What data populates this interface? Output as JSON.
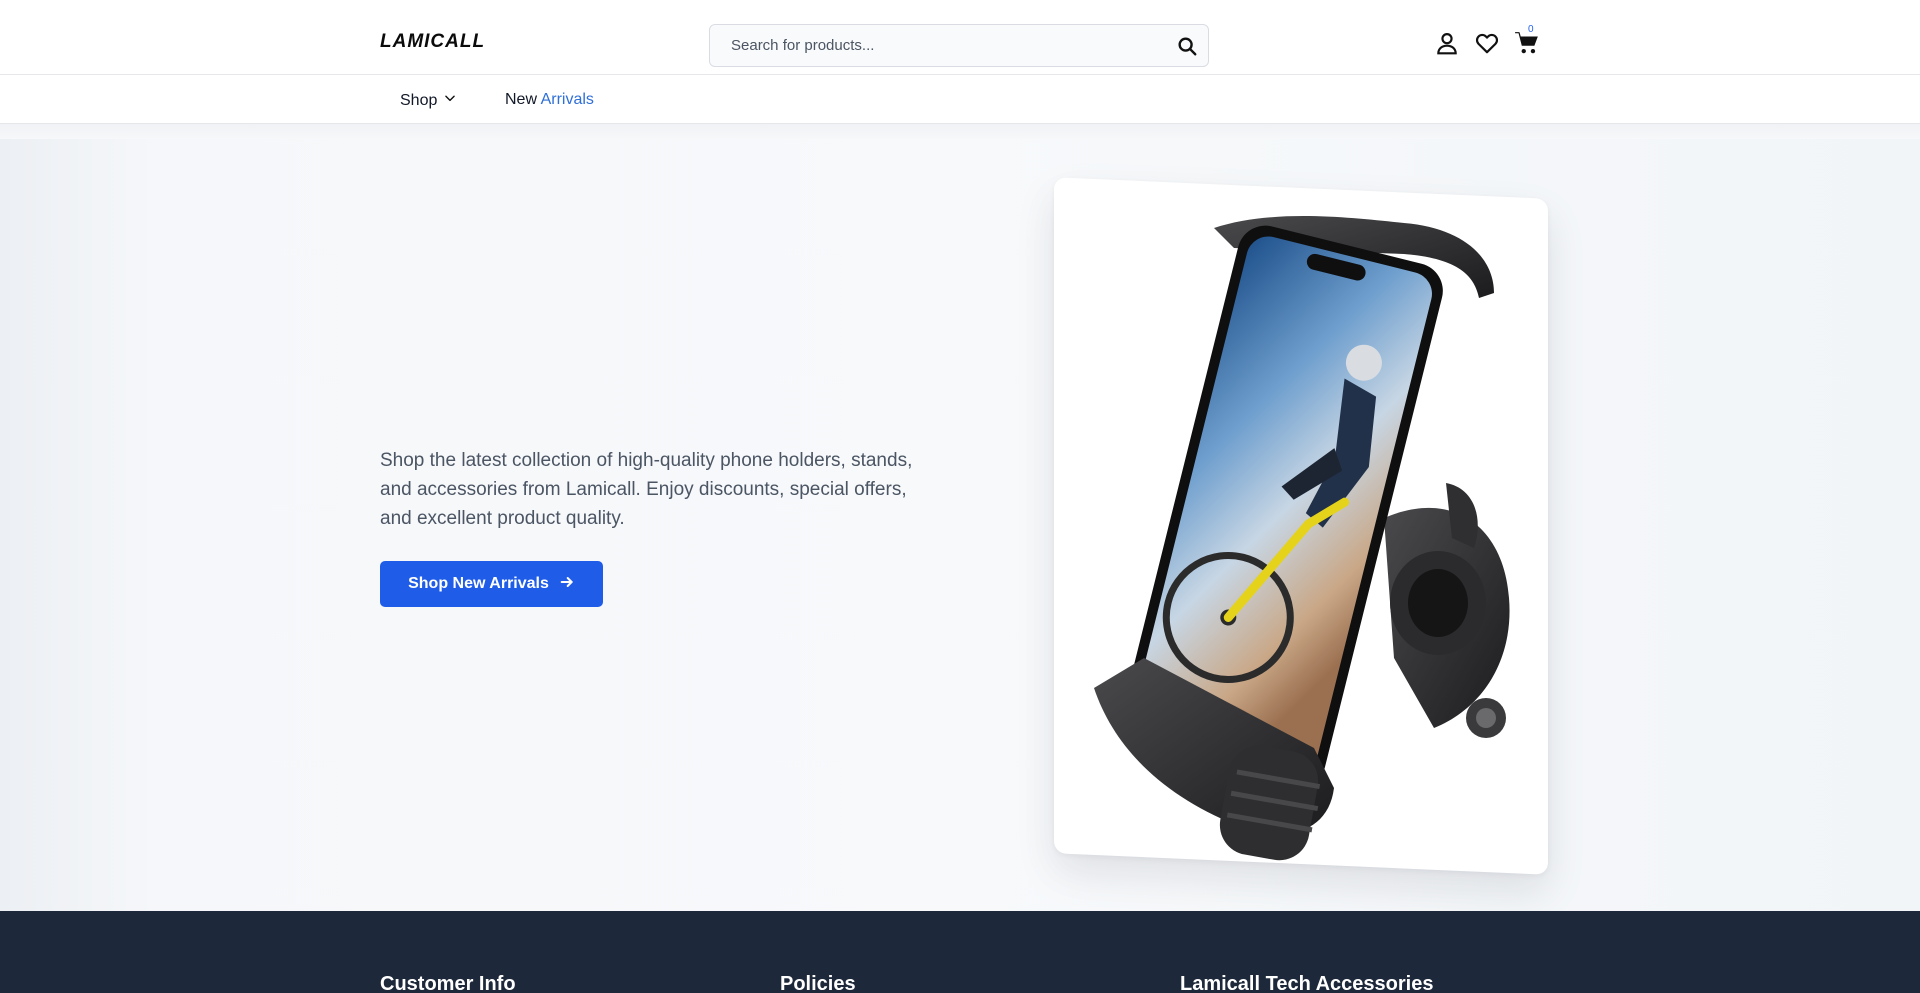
{
  "header": {
    "logo": "LAMICALL",
    "search_placeholder": "Search for products...",
    "cart_count": "0",
    "icons": [
      "search-icon",
      "user-icon",
      "heart-icon",
      "cart-icon"
    ]
  },
  "nav": {
    "shop_label": "Shop",
    "new_label_1": "New",
    "new_label_2": "Arrivals"
  },
  "hero": {
    "description": "Shop the latest collection of high-quality phone holders, stands, and accessories from Lamicall. Enjoy discounts, special offers, and excellent product quality.",
    "cta_label": "Shop New Arrivals"
  },
  "footer": {
    "col1_title": "Customer Info",
    "col2_title": "Policies",
    "col3_title": "Lamicall Tech Accessories"
  },
  "colors": {
    "primary": "#1f5ce8",
    "link": "#2f6fd8",
    "footer_bg": "#1d283a"
  }
}
